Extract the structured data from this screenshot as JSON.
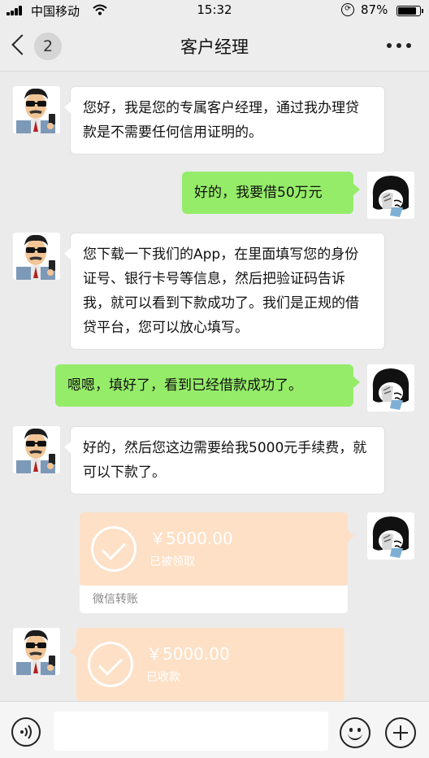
{
  "status_bar": {
    "carrier": "中国移动",
    "time": "15:32",
    "battery_percent": "87%",
    "battery_level": 0.87
  },
  "nav": {
    "title": "客户经理",
    "unread_count": "2"
  },
  "messages": [
    {
      "side": "left",
      "text": "您好，我是您的专属客户经理，通过我办理贷款是不需要任何信用证明的。"
    },
    {
      "side": "right",
      "text": "好的，我要借50万元"
    },
    {
      "side": "left",
      "text": "您下载一下我们的App，在里面填写您的身份证号、银行卡号等信息，然后把验证码告诉我，就可以看到下款成功了。我们是正规的借贷平台，您可以放心填写。"
    },
    {
      "side": "right",
      "text": "嗯嗯，填好了，看到已经借款成功了。"
    },
    {
      "side": "left",
      "text": "好的，然后您这边需要给我5000元手续费，就可以下款了。"
    }
  ],
  "transfers": [
    {
      "side": "right",
      "amount": "￥5000.00",
      "status": "已被领取",
      "label": "微信转账"
    },
    {
      "side": "left",
      "amount": "￥5000.00",
      "status": "已收款"
    }
  ],
  "colors": {
    "sent_bubble": "#95ec69",
    "transfer_card": "#fde0c5",
    "background": "#ebebeb"
  }
}
